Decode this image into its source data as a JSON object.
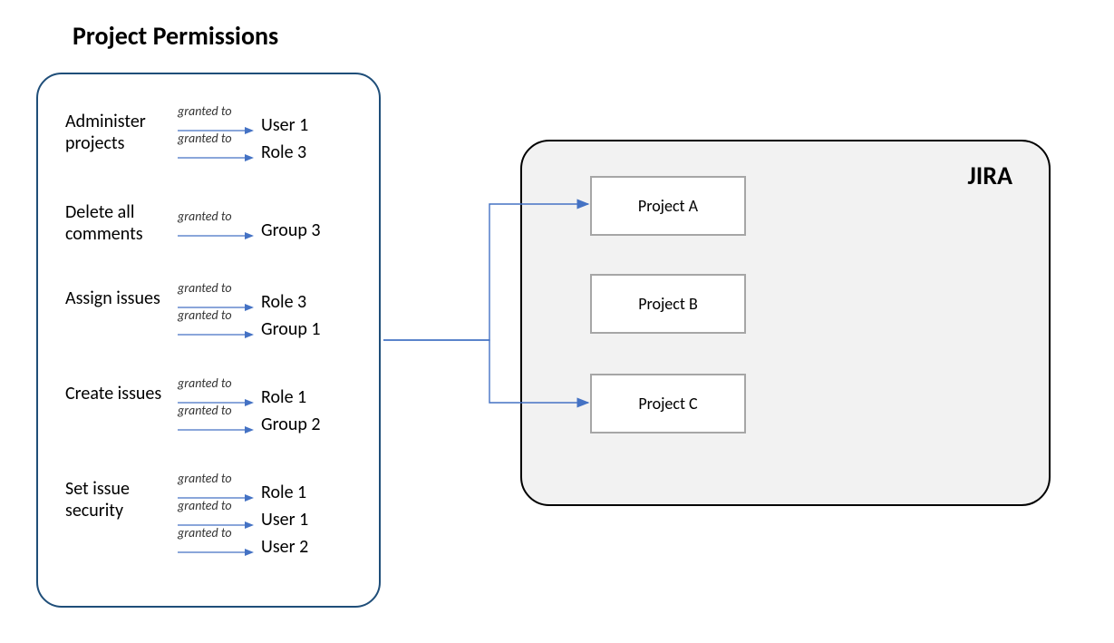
{
  "title": "Project Permissions",
  "grant_label": "granted to",
  "permissions": [
    {
      "name": "Administer projects",
      "grantees": [
        "User 1",
        "Role 3"
      ]
    },
    {
      "name": "Delete all comments",
      "grantees": [
        "Group 3"
      ]
    },
    {
      "name": "Assign issues",
      "grantees": [
        "Role 3",
        "Group 1"
      ]
    },
    {
      "name": "Create issues",
      "grantees": [
        "Role 1",
        "Group 2"
      ]
    },
    {
      "name": "Set issue security",
      "grantees": [
        "Role 1",
        "User 1",
        "User 2"
      ]
    }
  ],
  "jira": {
    "label": "JIRA",
    "projects": [
      "Project A",
      "Project B",
      "Project C"
    ]
  }
}
